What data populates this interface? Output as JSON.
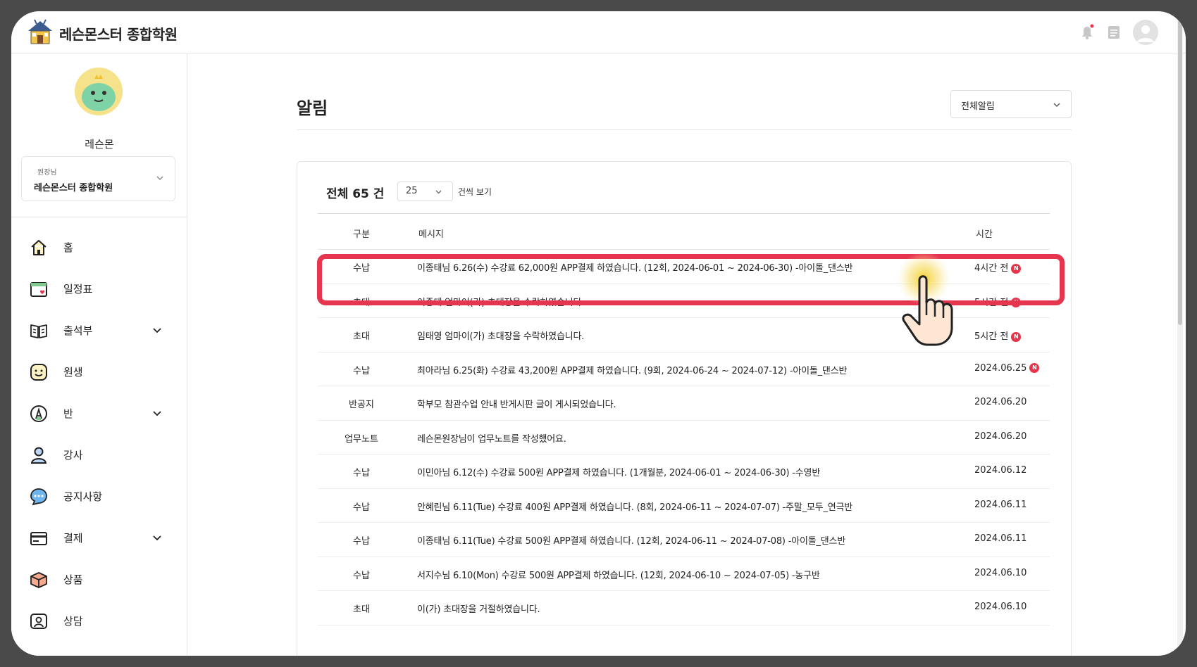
{
  "app": {
    "brand": "레슨몬스터 종합학원"
  },
  "profile": {
    "name": "레슨몬",
    "role": "원장님",
    "academy": "레슨몬스터 종합학원"
  },
  "nav": {
    "items": [
      {
        "label": "홈",
        "icon": "home-icon"
      },
      {
        "label": "일정표",
        "icon": "calendar-icon"
      },
      {
        "label": "출석부",
        "icon": "book-icon",
        "expandable": true
      },
      {
        "label": "원생",
        "icon": "smile-icon"
      },
      {
        "label": "반",
        "icon": "class-icon",
        "expandable": true
      },
      {
        "label": "강사",
        "icon": "person-icon"
      },
      {
        "label": "공지사항",
        "icon": "chat-icon"
      },
      {
        "label": "결제",
        "icon": "card-icon",
        "expandable": true
      },
      {
        "label": "상품",
        "icon": "box-icon"
      },
      {
        "label": "상담",
        "icon": "consult-icon"
      }
    ]
  },
  "page": {
    "title": "알림",
    "filter": "전체알림",
    "total": "전체 65 건",
    "per_page": "25",
    "per_page_suffix": "건씩 보기"
  },
  "table": {
    "headers": {
      "type": "구분",
      "message": "메시지",
      "time": "시간"
    },
    "new_badge": "N",
    "rows": [
      {
        "type": "수납",
        "message": "이종태님 6.26(수) 수강료 62,000원 APP결제 하였습니다. (12회, 2024-06-01 ~ 2024-06-30) -아이돌_댄스반",
        "time": "4시간 전",
        "new": true
      },
      {
        "type": "초대",
        "message": "이종태 엄마이(가) 초대장을 수락하였습니다.",
        "time": "5시간 전",
        "new": true
      },
      {
        "type": "초대",
        "message": "임태영 엄마이(가) 초대장을 수락하였습니다.",
        "time": "5시간 전",
        "new": true
      },
      {
        "type": "수납",
        "message": "최아라님 6.25(화) 수강료 43,200원 APP결제 하였습니다. (9회, 2024-06-24 ~ 2024-07-12) -아이돌_댄스반",
        "time": "2024.06.25",
        "new": true
      },
      {
        "type": "반공지",
        "message": "학부모 참관수업 안내 반게시판 글이 게시되었습니다.",
        "time": "2024.06.20",
        "new": false
      },
      {
        "type": "업무노트",
        "message": "레슨몬원장님이 업무노트를 작성했어요.",
        "time": "2024.06.20",
        "new": false
      },
      {
        "type": "수납",
        "message": "이민아님 6.12(수) 수강료 500원 APP결제 하였습니다. (1개월분, 2024-06-01 ~ 2024-06-30) -수영반",
        "time": "2024.06.12",
        "new": false
      },
      {
        "type": "수납",
        "message": "안혜린님 6.11(Tue) 수강료 400원 APP결제 하였습니다. (8회, 2024-06-11 ~ 2024-07-07) -주말_모두_연극반",
        "time": "2024.06.11",
        "new": false
      },
      {
        "type": "수납",
        "message": "이종태님 6.11(Tue) 수강료 500원 APP결제 하였습니다. (12회, 2024-06-11 ~ 2024-07-08) -아이돌_댄스반",
        "time": "2024.06.11",
        "new": false
      },
      {
        "type": "수납",
        "message": "서지수님 6.10(Mon) 수강료 500원 APP결제 하였습니다. (12회, 2024-06-10 ~ 2024-07-05) -농구반",
        "time": "2024.06.10",
        "new": false
      },
      {
        "type": "초대",
        "message": "이(가) 초대장을 거절하였습니다.",
        "time": "2024.06.10",
        "new": false
      }
    ]
  },
  "colors": {
    "highlight": "#e6354f",
    "badge": "#e8334a",
    "cursor_glow": "#f5d020"
  }
}
